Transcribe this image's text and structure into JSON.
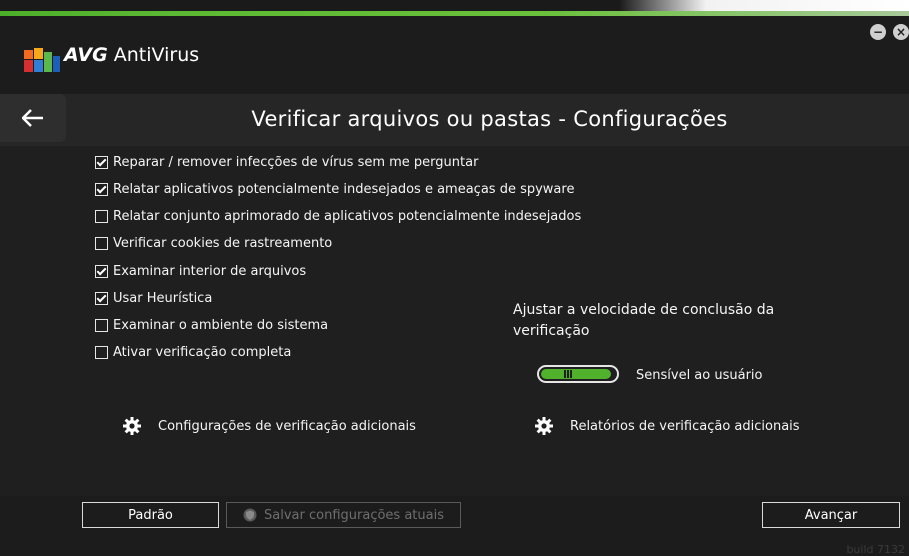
{
  "app": {
    "brand_bold": "AVG",
    "brand_name": "AntiVirus"
  },
  "window_controls": {
    "minimize_label": "−",
    "close_label": "×"
  },
  "header": {
    "back_icon": "left-arrow-icon",
    "title": "Verificar arquivos ou pastas - Configurações"
  },
  "options": [
    {
      "label": "Reparar / remover infecções de vírus sem me perguntar",
      "checked": true
    },
    {
      "label": "Relatar aplicativos potencialmente indesejados e ameaças de spyware",
      "checked": true
    },
    {
      "label": "Relatar conjunto aprimorado de aplicativos potencialmente indesejados",
      "checked": false
    },
    {
      "label": "Verificar cookies de rastreamento",
      "checked": false
    },
    {
      "label": "Examinar interior de arquivos",
      "checked": true
    },
    {
      "label": "Usar Heurística",
      "checked": true
    },
    {
      "label": "Examinar o ambiente do sistema",
      "checked": false
    },
    {
      "label": "Ativar verificação completa",
      "checked": false
    }
  ],
  "speed": {
    "title": "Ajustar a velocidade de conclusão da verificação",
    "slider_label": "Sensível ao usuário",
    "level": 0.95
  },
  "links": {
    "additional_settings": "Configurações de verificação adicionais",
    "additional_reports": "Relatórios de verificação adicionais"
  },
  "footer": {
    "default_button": "Padrão",
    "save_button": "Salvar configurações atuais",
    "next_button": "Avançar",
    "build": "build 7132"
  },
  "colors": {
    "accent_green": "#51b12d",
    "background": "#1f1f1f"
  }
}
